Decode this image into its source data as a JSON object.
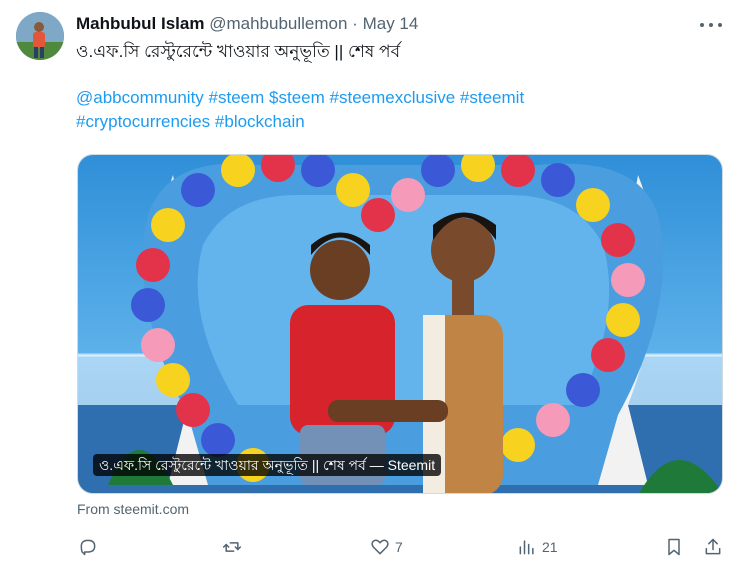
{
  "tweet": {
    "author_name": "Mahbubul Islam",
    "handle": "@mahbubullemon",
    "separator": "·",
    "date": "May 14",
    "text_line": "ও.এফ.সি রেস্টুরেন্টে খাওয়ার অনুভূতি || শেষ পর্ব",
    "hashtags": [
      "@abbcommunity",
      "#steem",
      "$steem",
      "#steemexclusive",
      "#steemit",
      "#cryptocurrencies",
      "#blockchain"
    ],
    "card_caption": "ও.এফ.সি রেস্টুরেন্টে খাওয়ার অনুভূতি || শেষ পর্ব — Steemit",
    "source": "From steemit.com"
  },
  "actions": {
    "reply_icon": "reply-icon",
    "retweet_icon": "retweet-icon",
    "like_icon": "heart-icon",
    "like_count": "7",
    "views_icon": "views-icon",
    "views_count": "21",
    "bookmark_icon": "bookmark-icon",
    "share_icon": "share-icon"
  },
  "colors": {
    "link": "#1d9bf0",
    "secondary_text": "#536471",
    "primary_text": "#0f1419"
  }
}
